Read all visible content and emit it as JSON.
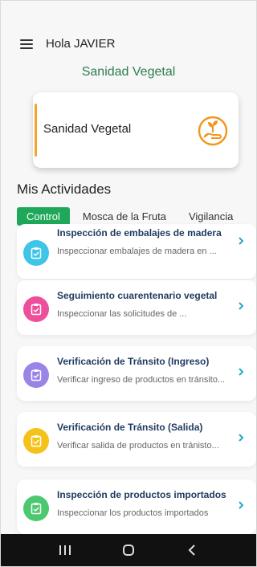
{
  "header": {
    "greeting": "Hola JAVIER",
    "app_title": "Sanidad Vegetal"
  },
  "module_card": {
    "label": "Sanidad Vegetal",
    "accent_color": "#f2a52a"
  },
  "activities_section": {
    "title": "Mis Actividades",
    "tabs": [
      {
        "label": "Control",
        "active": true
      },
      {
        "label": "Mosca de la Fruta",
        "active": false
      },
      {
        "label": "Vigilancia",
        "active": false
      }
    ],
    "items": [
      {
        "title": "Inspección de embalajes de madera",
        "description": "Inspeccionar embalajes de madera en ...",
        "icon_color": "#3ec5e8",
        "icon": "clipboard-check-icon"
      },
      {
        "title": "Seguimiento cuarentenario vegetal",
        "description": "Inspeccionar las solicitudes de ...",
        "icon_color": "#ee4f9a",
        "icon": "clipboard-check-icon"
      },
      {
        "title": "Verificación de Tránsito (Ingreso)",
        "description": "Verificar ingreso de productos en tránsito...",
        "icon_color": "#9b84e8",
        "icon": "clipboard-check-icon"
      },
      {
        "title": "Verificación de Tránsito (Salida)",
        "description": "Verificar salida de productos en tránisto...",
        "icon_color": "#f5c21b",
        "icon": "clipboard-check-icon"
      },
      {
        "title": "Inspección de productos importados",
        "description": "Inspeccionar los productos importados",
        "icon_color": "#4cc870",
        "icon": "clipboard-check-icon"
      }
    ]
  },
  "colors": {
    "primary_green": "#1fa85a",
    "title_green": "#2e7d4f",
    "chevron": "#2aa6c8"
  }
}
